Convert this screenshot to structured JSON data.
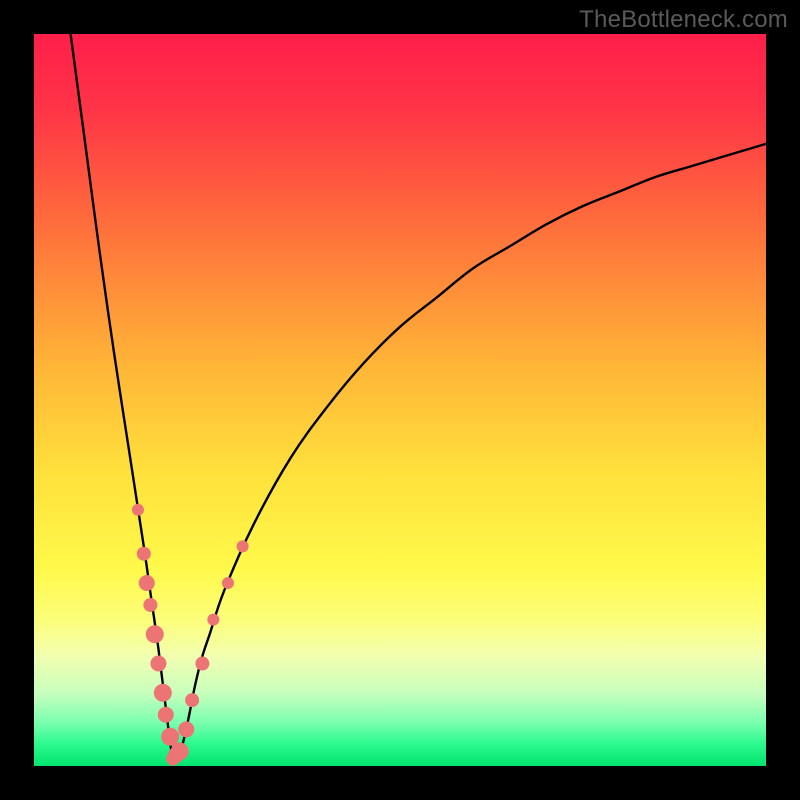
{
  "watermark": "TheBottleneck.com",
  "colors": {
    "frame": "#000000",
    "curve": "#000000",
    "marker_fill": "#ed7474",
    "marker_stroke": "#c85a5a",
    "gradient_stops": [
      {
        "offset": 0.0,
        "color": "#ff1f4a"
      },
      {
        "offset": 0.1,
        "color": "#ff3347"
      },
      {
        "offset": 0.25,
        "color": "#ff6a3c"
      },
      {
        "offset": 0.45,
        "color": "#ffb437"
      },
      {
        "offset": 0.6,
        "color": "#ffe13c"
      },
      {
        "offset": 0.73,
        "color": "#fff94a"
      },
      {
        "offset": 0.8,
        "color": "#fdfe7a"
      },
      {
        "offset": 0.85,
        "color": "#f2ffb0"
      },
      {
        "offset": 0.9,
        "color": "#c8ffbd"
      },
      {
        "offset": 0.94,
        "color": "#7cffb0"
      },
      {
        "offset": 0.97,
        "color": "#2cf98e"
      },
      {
        "offset": 1.0,
        "color": "#02e56e"
      }
    ]
  },
  "chart_data": {
    "type": "line",
    "title": "",
    "xlabel": "",
    "ylabel": "",
    "xlim": [
      0,
      100
    ],
    "ylim": [
      0,
      100
    ],
    "grid": false,
    "legend": false,
    "notes": "V-shaped bottleneck curve. Deep minimum near x≈19. Left branch rises very steeply to y≈100 at x≈5. Right branch rises with diminishing slope toward y≈85 at x=100. Pink markers cluster on both branches near the bottom (y≲30).",
    "series": [
      {
        "name": "bottleneck-curve",
        "x": [
          5,
          7,
          9,
          11,
          13,
          15,
          16,
          17,
          18,
          19,
          20,
          21,
          22,
          23,
          24,
          26,
          30,
          35,
          40,
          45,
          50,
          55,
          60,
          65,
          70,
          75,
          80,
          85,
          90,
          95,
          100
        ],
        "y": [
          100,
          85,
          70,
          56,
          43,
          30,
          23,
          16,
          8,
          1,
          2,
          6,
          11,
          15,
          18,
          24,
          33,
          42,
          49,
          55,
          60,
          64,
          68,
          71,
          74,
          76.5,
          78.5,
          80.5,
          82,
          83.5,
          85
        ]
      }
    ],
    "markers": [
      {
        "x": 14.2,
        "y": 35,
        "r": 6
      },
      {
        "x": 15.0,
        "y": 29,
        "r": 7
      },
      {
        "x": 15.4,
        "y": 25,
        "r": 8
      },
      {
        "x": 15.9,
        "y": 22,
        "r": 7
      },
      {
        "x": 16.5,
        "y": 18,
        "r": 9
      },
      {
        "x": 17.0,
        "y": 14,
        "r": 8
      },
      {
        "x": 17.6,
        "y": 10,
        "r": 9
      },
      {
        "x": 18.0,
        "y": 7,
        "r": 8
      },
      {
        "x": 18.6,
        "y": 4,
        "r": 9
      },
      {
        "x": 19.0,
        "y": 1,
        "r": 7
      },
      {
        "x": 19.4,
        "y": 1.5,
        "r": 8
      },
      {
        "x": 19.9,
        "y": 2,
        "r": 9
      },
      {
        "x": 20.8,
        "y": 5,
        "r": 8
      },
      {
        "x": 21.6,
        "y": 9,
        "r": 7
      },
      {
        "x": 23.0,
        "y": 14,
        "r": 7
      },
      {
        "x": 24.5,
        "y": 20,
        "r": 6
      },
      {
        "x": 26.5,
        "y": 25,
        "r": 6
      },
      {
        "x": 28.5,
        "y": 30,
        "r": 6
      }
    ]
  }
}
